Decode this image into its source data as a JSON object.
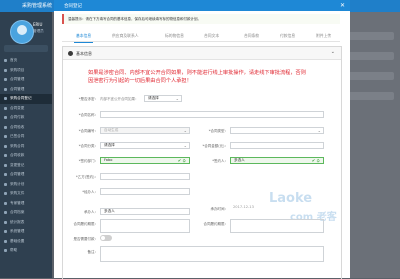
{
  "app": {
    "title": "采购管理系统",
    "user_info": ""
  },
  "sidebar": {
    "user_name": "ERIU",
    "user_role": "管理员",
    "items": [
      {
        "label": "首页"
      },
      {
        "label": "采购项目"
      },
      {
        "label": "合同管理"
      },
      {
        "label": "合同管理"
      },
      {
        "label": "采购合同登记"
      },
      {
        "label": "合同变更"
      },
      {
        "label": "合同付款"
      },
      {
        "label": "合同验收"
      },
      {
        "label": "已签合同"
      },
      {
        "label": "采购合同"
      },
      {
        "label": "合同收款"
      },
      {
        "label": "变更登记"
      },
      {
        "label": "合同管理"
      },
      {
        "label": "采购计划"
      },
      {
        "label": "采购文件"
      },
      {
        "label": "专家管理"
      },
      {
        "label": "合同档案"
      },
      {
        "label": "统计报表"
      },
      {
        "label": "系统管理"
      },
      {
        "label": "基础设置"
      },
      {
        "label": "帮助"
      }
    ]
  },
  "modal": {
    "title": "合同登记",
    "close": "✕",
    "notice": "温馨提示：请在下方填写合同的基本信息，保存后可继续填写标的物信息和付款计划。",
    "tabs": [
      "基本信息",
      "供应商及联系人",
      "标的物信息",
      "合同文本",
      "合同条款",
      "付款信息",
      "附件上传"
    ],
    "section_title": "基本信息",
    "warning": "如果是涉密合同、内部不宜公开合同如果，则不能进行线上审批操作，请走线下审批流程，否则因泄密行为引起的一切后果由合同个人承担！",
    "fields": {
      "secret_label": "*是否涉密：",
      "secret_hint": "内部不宜公开合同如果：",
      "secret_value": "请选择",
      "contract_name_label": "*合同名称：",
      "contract_no_label": "*合同编号：",
      "contract_no_value": "自动生成",
      "contract_type_label": "*合同类型：",
      "contract_cat_label": "*合同分类：",
      "contract_cat_value": "请选择",
      "amount_label": "*合同金额(元)：",
      "signer_label": "*签约部门：",
      "signer_value": "Fabo",
      "person_label": "*签约人：",
      "person_value": "多选人",
      "party_label": "*乙方(签约)：",
      "handler_label": "*经办人：",
      "contact_label": "承办人：",
      "contact_value": "多选人",
      "date_label": "承办时间：",
      "date_value": "2017-12-13",
      "start_label": "合同履约期限：",
      "end_label": "合同履约期限：",
      "switch_label": "是否需要付款：",
      "remark_label": "备注："
    },
    "watermark_1": "Laoke",
    "watermark_2": "com 老客"
  }
}
